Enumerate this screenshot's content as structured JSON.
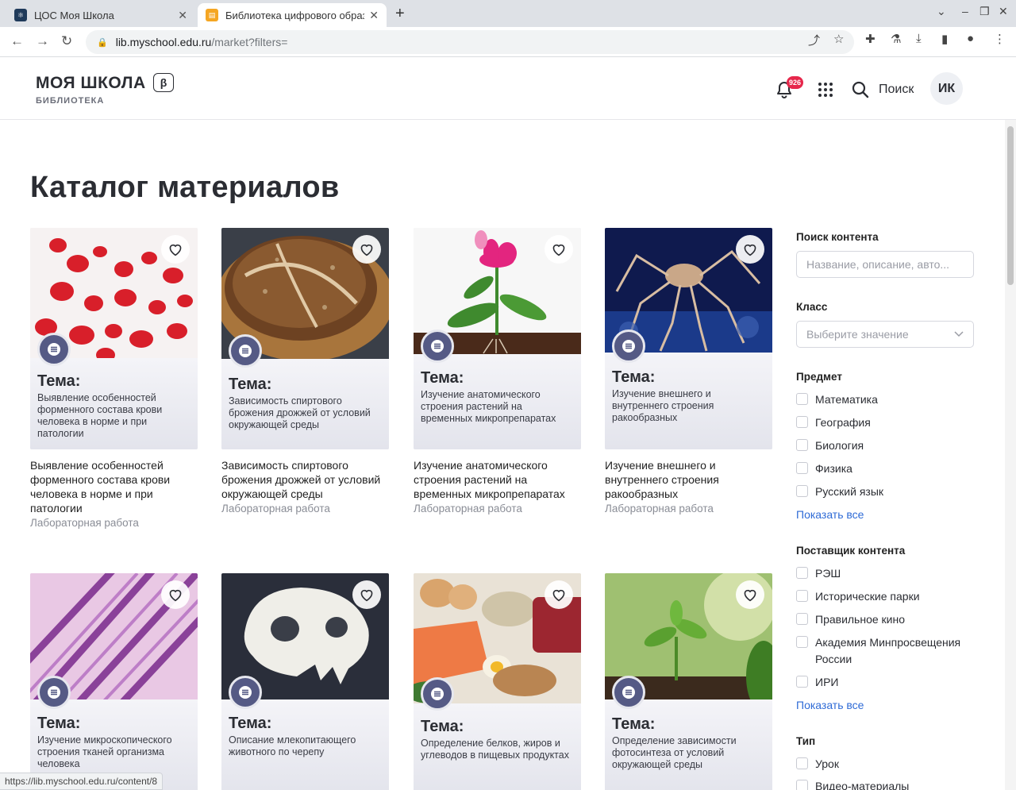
{
  "browser": {
    "tabs": [
      {
        "label": "ЦОС Моя Школа"
      },
      {
        "label": "Библиотека цифрового образования"
      }
    ],
    "url_host": "lib.myschool.edu.ru",
    "url_path": "/market?filters=",
    "status_url": "https://lib.myschool.edu.ru/content/8"
  },
  "header": {
    "logo": "МОЯ ШКОЛА",
    "beta": "β",
    "subtitle": "БИБЛИОТЕКА",
    "notif_count": "926",
    "search_label": "Поиск",
    "avatar_initials": "ИК"
  },
  "page": {
    "title": "Каталог материалов"
  },
  "cards": [
    {
      "tema": "Тема:",
      "desc": "Выявление особенностей форменного состава крови человека в норме и при патологии",
      "title": "Выявление особенностей форменного состава крови человека в норме и при патологии",
      "type": "Лабораторная работа"
    },
    {
      "tema": "Тема:",
      "desc": "Зависимость спиртового брожения дрожжей от условий окружающей среды",
      "title": "Зависимость спиртового брожения дрожжей от условий окружающей среды",
      "type": "Лабораторная работа"
    },
    {
      "tema": "Тема:",
      "desc": "Изучение анатомического строения растений на временных микропрепаратах",
      "title": "Изучение анатомического строения растений на временных микропрепаратах",
      "type": "Лабораторная работа"
    },
    {
      "tema": "Тема:",
      "desc": "Изучение внешнего и внутреннего строения ракообразных",
      "title": "Изучение внешнего и внутреннего строения ракообразных",
      "type": "Лабораторная работа"
    },
    {
      "tema": "Тема:",
      "desc": "Изучение микроскопического строения тканей организма человека"
    },
    {
      "tema": "Тема:",
      "desc": "Описание млекопитающего животного по черепу"
    },
    {
      "tema": "Тема:",
      "desc": "Определение белков, жиров и углеводов в пищевых продуктах"
    },
    {
      "tema": "Тема:",
      "desc": "Определение зависимости фотосинтеза от условий окружающей среды"
    }
  ],
  "sidebar": {
    "search_heading": "Поиск контента",
    "search_placeholder": "Название, описание, авто...",
    "class_heading": "Класс",
    "class_placeholder": "Выберите значение",
    "subject_heading": "Предмет",
    "subjects": [
      "Математика",
      "География",
      "Биология",
      "Физика",
      "Русский язык"
    ],
    "show_all": "Показать все",
    "provider_heading": "Поставщик контента",
    "providers": [
      "РЭШ",
      "Исторические парки",
      "Правильное кино",
      "Академия Минпросвещения России",
      "ИРИ"
    ],
    "type_heading": "Тип",
    "types": [
      "Урок",
      "Видео-материалы"
    ]
  },
  "colors": {
    "accent": "#2f6bd6",
    "badge": "#e6274b",
    "doc_icon": "#555a85"
  }
}
